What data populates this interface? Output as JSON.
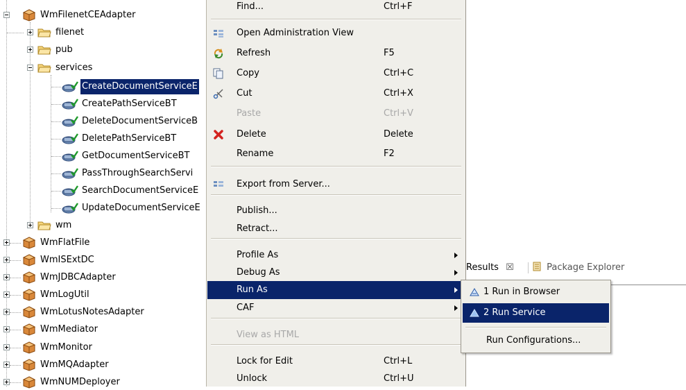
{
  "tree": {
    "root_package": "WmFilenetCEAdapter",
    "folders": [
      "filenet",
      "pub",
      "services",
      "wm"
    ],
    "services": [
      "CreateDocumentServiceE",
      "CreatePathServiceBT",
      "DeleteDocumentServiceB",
      "DeletePathServiceBT",
      "GetDocumentServiceBT",
      "PassThroughSearchServi",
      "SearchDocumentServiceE",
      "UpdateDocumentServiceE"
    ],
    "selected_service": "CreateDocumentServiceE",
    "packages": [
      "WmFlatFile",
      "WmISExtDC",
      "WmJDBCAdapter",
      "WmLogUtil",
      "WmLotusNotesAdapter",
      "WmMediator",
      "WmMonitor",
      "WmMQAdapter",
      "WmNUMDeployer"
    ]
  },
  "context_menu": {
    "items": [
      {
        "label": "Find...",
        "accel": "Ctrl+F"
      },
      {
        "label": "Open Administration View",
        "accel": "",
        "icon": "admin-view-icon"
      },
      {
        "label": "Refresh",
        "accel": "F5",
        "icon": "refresh-icon"
      },
      {
        "label": "Copy",
        "accel": "Ctrl+C",
        "icon": "copy-icon"
      },
      {
        "label": "Cut",
        "accel": "Ctrl+X",
        "icon": "cut-icon"
      },
      {
        "label": "Paste",
        "accel": "Ctrl+V",
        "disabled": true
      },
      {
        "label": "Delete",
        "accel": "Delete",
        "icon": "delete-icon"
      },
      {
        "label": "Rename",
        "accel": "F2"
      },
      {
        "label": "Export from Server...",
        "accel": "",
        "icon": "export-icon"
      },
      {
        "label": "Publish...",
        "accel": ""
      },
      {
        "label": "Retract...",
        "accel": ""
      },
      {
        "label": "Profile As",
        "accel": "",
        "submenu": true
      },
      {
        "label": "Debug As",
        "accel": "",
        "submenu": true
      },
      {
        "label": "Run As",
        "accel": "",
        "submenu": true,
        "active": true
      },
      {
        "label": "CAF",
        "accel": "",
        "submenu": true
      },
      {
        "label": "View as HTML",
        "accel": "",
        "disabled": true
      },
      {
        "label": "Lock for Edit",
        "accel": "Ctrl+L"
      },
      {
        "label": "Unlock",
        "accel": "Ctrl+U"
      }
    ]
  },
  "submenu": {
    "items": [
      {
        "label": "1 Run in Browser",
        "icon": "run-in-browser-icon"
      },
      {
        "label": "2 Run Service",
        "icon": "run-service-icon",
        "active": true
      },
      {
        "label": "Run Configurations..."
      }
    ]
  },
  "background_tabs": {
    "results": "Results",
    "results_close": "☒",
    "package_explorer": "Package Explorer"
  },
  "colors": {
    "selection": "#0a246a",
    "menu_bg": "#f0efea",
    "disabled_text": "#a8a8a8"
  }
}
